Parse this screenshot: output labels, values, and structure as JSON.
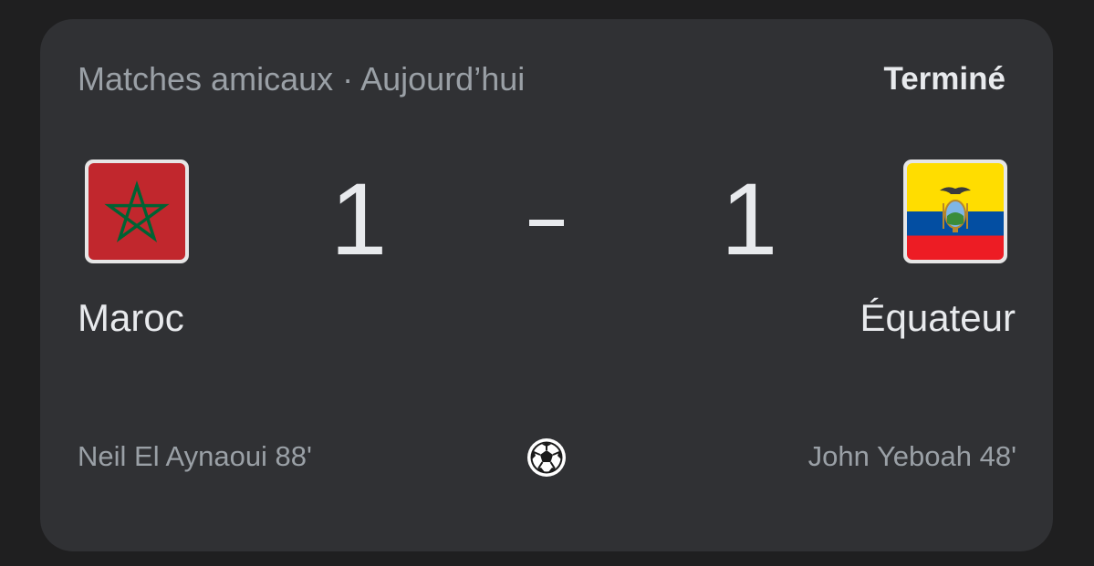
{
  "header": {
    "competition": "Matches amicaux · Aujourd’hui",
    "status": "Terminé"
  },
  "home": {
    "name": "Maroc",
    "score": "1",
    "scorer": "Neil El Aynaoui 88'",
    "flag_icon": "morocco-flag-icon",
    "flag_color": "#c1272d",
    "star_color": "#006233"
  },
  "away": {
    "name": "Équateur",
    "score": "1",
    "scorer": "John Yeboah 48'",
    "flag_icon": "ecuador-flag-icon",
    "flag_colors": [
      "#ffdd00",
      "#034ea2",
      "#ed1c24"
    ]
  },
  "separator": "–",
  "goal_icon": "soccer-ball-icon",
  "colors": {
    "background": "#1f1f20",
    "card": "#303134",
    "primary_text": "#e8eaed",
    "secondary_text": "#9aa0a6"
  }
}
